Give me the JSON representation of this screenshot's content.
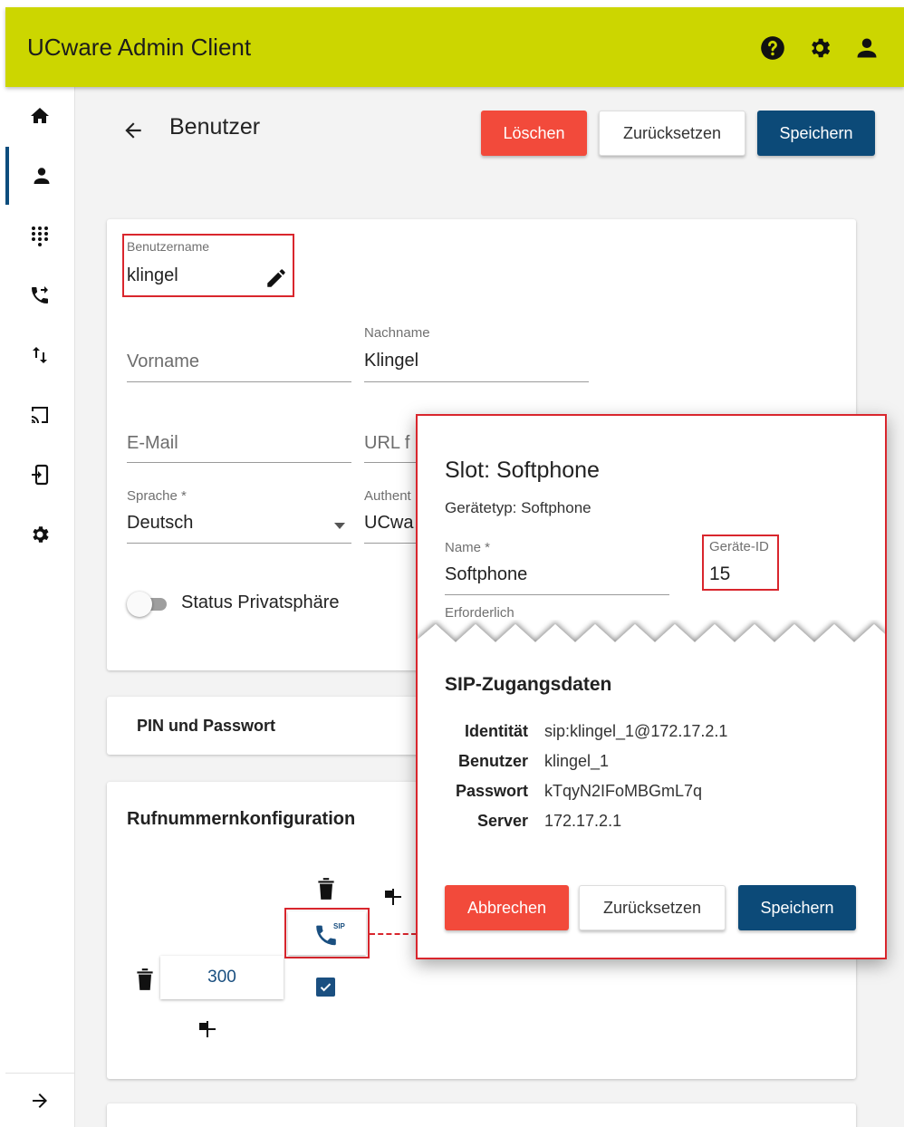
{
  "app": {
    "title": "UCware Admin Client"
  },
  "page": {
    "title": "Benutzer",
    "delete_label": "Löschen",
    "reset_label": "Zurücksetzen",
    "save_label": "Speichern"
  },
  "form": {
    "username_label": "Benutzername",
    "username_value": "klingel",
    "firstname_placeholder": "Vorname",
    "lastname_label": "Nachname",
    "lastname_value": "Klingel",
    "email_placeholder": "E-Mail",
    "url_placeholder": "URL f",
    "language_label": "Sprache *",
    "language_value": "Deutsch",
    "auth_label": "Authent",
    "auth_value": "UCwa",
    "privacy_label": "Status Privatsphäre",
    "privacy_enabled": false
  },
  "pin_section": {
    "title": "PIN und Passwort"
  },
  "number_section": {
    "title": "Rufnummernkonfiguration",
    "number_value": "300",
    "slot_badge": "SIP",
    "slot_checked": true
  },
  "dialog": {
    "title": "Slot: Softphone",
    "device_type": "Gerätetyp: Softphone",
    "name_label": "Name *",
    "name_value": "Softphone",
    "required_hint": "Erforderlich",
    "device_id_label": "Geräte-ID",
    "device_id_value": "15",
    "sip_title": "SIP-Zugangsdaten",
    "sip": [
      {
        "key": "Identität",
        "value": "sip:klingel_1@172.17.2.1"
      },
      {
        "key": "Benutzer",
        "value": "klingel_1"
      },
      {
        "key": "Passwort",
        "value": "kTqyN2IFoMBGmL7q"
      },
      {
        "key": "Server",
        "value": "172.17.2.1"
      }
    ],
    "cancel_label": "Abbrechen",
    "reset_label": "Zurücksetzen",
    "save_label": "Speichern"
  },
  "colors": {
    "appbar": "#ccd600",
    "primary": "#0c4a78",
    "danger": "#f24a3b",
    "highlight": "#d9262d"
  }
}
